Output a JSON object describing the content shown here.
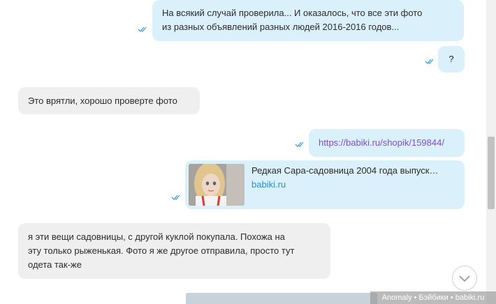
{
  "messages": [
    {
      "direction": "out",
      "text_line1": "На всякий случай проверила... И оказалось, что все эти фото",
      "text_line2": "из разных объявлений разных людей 2016-2016 годов...",
      "status": "read"
    },
    {
      "direction": "out",
      "text": "?",
      "status": "read"
    },
    {
      "direction": "in",
      "text": "Это врятли, хорошо проверте фото"
    },
    {
      "direction": "out",
      "link": "https://babiki.ru/shopik/159844/",
      "status": "read"
    },
    {
      "direction": "out",
      "preview": {
        "title": "Редкая Сара-садовница 2004 года выпуск…",
        "domain": "babiki.ru"
      },
      "status": "read"
    },
    {
      "direction": "in",
      "text_line1": "я эти вещи садовницы, с другой куклой покупала. Похожа на",
      "text_line2": "эту только рыженькая. Фото я же другое отправила, просто тут",
      "text_line3": "одета так-же"
    }
  ],
  "watermark": "Anomaly • Бэйбики • babiki.ru",
  "colors": {
    "outgoing": "#daf1fb",
    "incoming": "#efefef",
    "tick": "#3ea2d9",
    "link": "#7b4fc7"
  },
  "icons": {
    "read_status": "double-check-icon",
    "scroll_down": "chevron-down-icon"
  }
}
